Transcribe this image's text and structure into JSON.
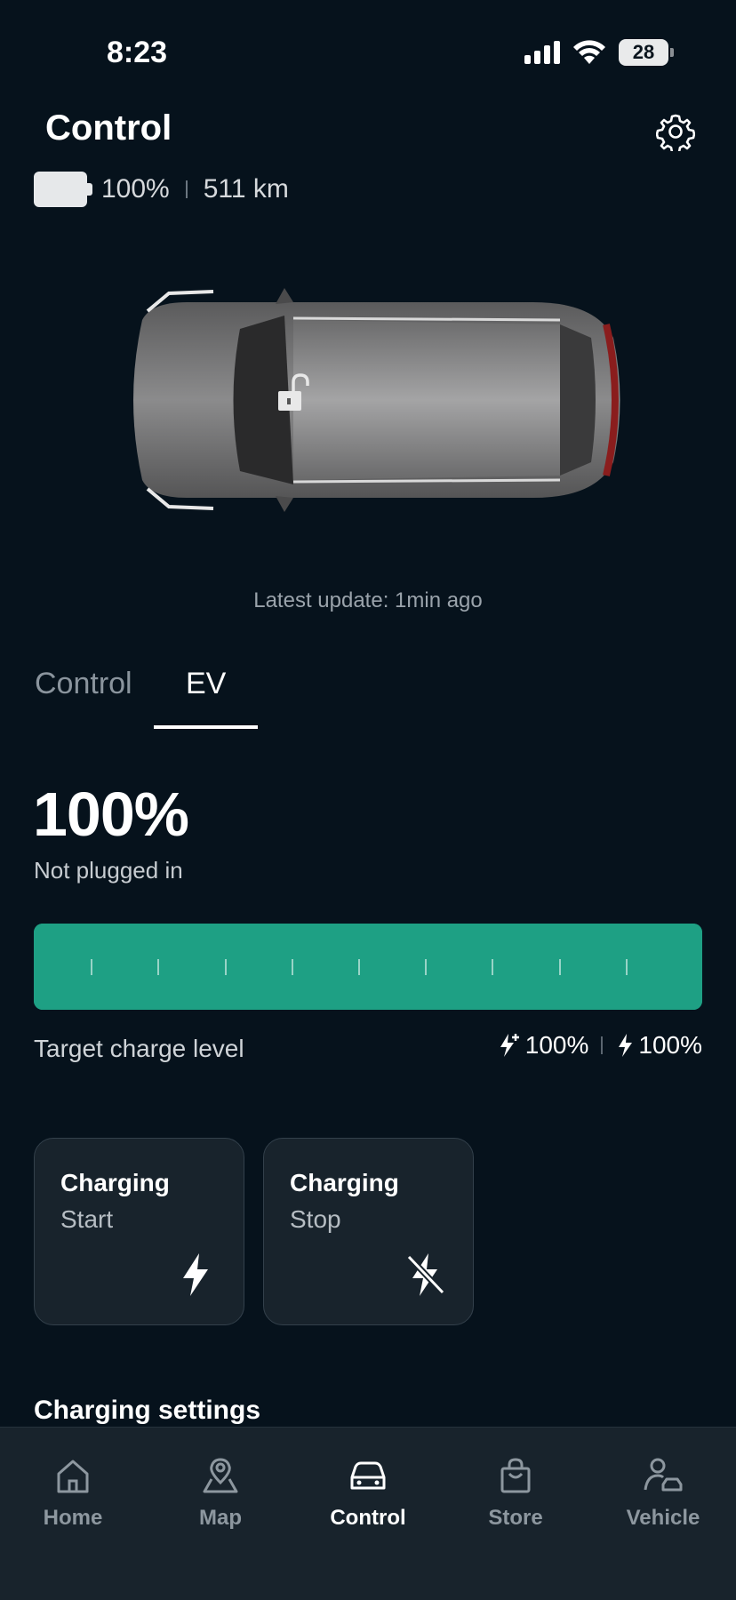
{
  "status_bar": {
    "time": "8:23",
    "battery": "28"
  },
  "header": {
    "title": "Control"
  },
  "summary": {
    "battery_percent": "100%",
    "range": "511 km"
  },
  "car": {
    "lock_state": "unlocked"
  },
  "update": {
    "text": "Latest update: 1min ago"
  },
  "tabs": [
    {
      "label": "Control",
      "active": false
    },
    {
      "label": "EV",
      "active": true
    }
  ],
  "ev": {
    "percent": "100%",
    "status": "Not plugged in",
    "charge_level": 1.0,
    "bar_color": "#1ea084",
    "target_label": "Target charge level",
    "target_fast": "100%",
    "target_normal": "100%"
  },
  "actions": [
    {
      "title": "Charging",
      "subtitle": "Start",
      "icon": "lightning-icon"
    },
    {
      "title": "Charging",
      "subtitle": "Stop",
      "icon": "lightning-off-icon"
    }
  ],
  "section": {
    "title": "Charging settings"
  },
  "nav": [
    {
      "label": "Home",
      "icon": "home-icon",
      "active": false
    },
    {
      "label": "Map",
      "icon": "map-pin-icon",
      "active": false
    },
    {
      "label": "Control",
      "icon": "car-icon",
      "active": true
    },
    {
      "label": "Store",
      "icon": "bag-icon",
      "active": false
    },
    {
      "label": "Vehicle",
      "icon": "user-car-icon",
      "active": false
    }
  ]
}
